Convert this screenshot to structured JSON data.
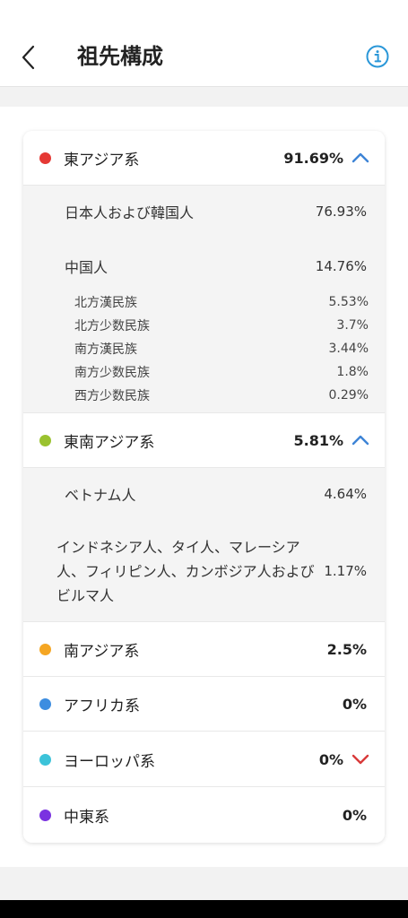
{
  "header": {
    "title": "祖先構成",
    "back_icon": "chevron-left-icon",
    "info_icon": "info-icon"
  },
  "colors": {
    "accent": "#2a97d8",
    "red": "#e53935",
    "green": "#9ac22f",
    "orange": "#f5a623",
    "blue": "#3d8de0",
    "cyan": "#3cc3d9",
    "purple": "#7a32e0",
    "chevron_blue": "#3d84d6",
    "chevron_red": "#d93a3a"
  },
  "groups": [
    {
      "label": "東アジア系",
      "value": "91.69%",
      "dot_color": "#e53935",
      "chevron": "up",
      "subs": [
        {
          "label": "日本人および韓国人",
          "value": "76.93%"
        },
        {
          "label": "中国人",
          "value": "14.76%",
          "children": [
            {
              "label": "北方漢民族",
              "value": "5.53%"
            },
            {
              "label": "北方少数民族",
              "value": "3.7%"
            },
            {
              "label": "南方漢民族",
              "value": "3.44%"
            },
            {
              "label": "南方少数民族",
              "value": "1.8%"
            },
            {
              "label": "西方少数民族",
              "value": "0.29%"
            }
          ]
        }
      ]
    },
    {
      "label": "東南アジア系",
      "value": "5.81%",
      "dot_color": "#9ac22f",
      "chevron": "up",
      "subs": [
        {
          "label": "ベトナム人",
          "value": "4.64%"
        },
        {
          "label": "インドネシア人、タイ人、マレーシア人、フィリピン人、カンボジア人およびビルマ人",
          "value": "1.17%"
        }
      ]
    },
    {
      "label": "南アジア系",
      "value": "2.5%",
      "dot_color": "#f5a623",
      "chevron": "none"
    },
    {
      "label": "アフリカ系",
      "value": "0%",
      "dot_color": "#3d8de0",
      "chevron": "none"
    },
    {
      "label": "ヨーロッパ系",
      "value": "0%",
      "dot_color": "#3cc3d9",
      "chevron": "down"
    },
    {
      "label": "中東系",
      "value": "0%",
      "dot_color": "#7a32e0",
      "chevron": "none"
    }
  ]
}
